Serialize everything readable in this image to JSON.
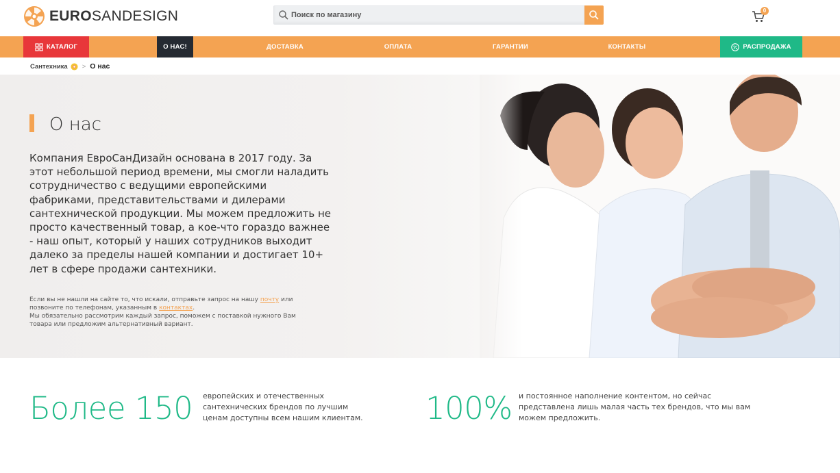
{
  "header": {
    "logo_bold": "EURO",
    "logo_rest": "SANDESIGN",
    "search_placeholder": "Поиск по магазину",
    "cart_count": "0"
  },
  "nav": {
    "catalog": "Каталог",
    "about": "О нас!",
    "delivery": "Доставка",
    "payment": "Оплата",
    "guarantee": "Гарантии",
    "contacts": "Контакты",
    "sale": "Распродажа"
  },
  "breadcrumb": {
    "home": "Сантехника",
    "separator": ">",
    "current": "О нас"
  },
  "hero": {
    "title": "О нас",
    "body": "Компания ЕвроСанДизайн основана в 2017 году. За этот небольшой период времени, мы смогли наладить сотрудничество с ведущими европейскими фабриками, представительствами и дилерами сантехнической продукции. Мы можем предложить не просто качественный товар, а кое-что гораздо важнее - наш опыт, который у наших сотрудников выходит далеко за пределы нашей компании и достигает 10+ лет в сфере продажи сантехники.",
    "note_1": "Если вы не нашли на сайте то, что искали, отправьте запрос на нашу",
    "note_link_mail": "почту",
    "note_2": "или позвоните по телефонам, указанным в",
    "note_link_contacts": "контактах",
    "note_3": ".",
    "note_4": "Мы обязательно рассмотрим каждый запрос, поможем с поставкой нужного Вам товара или предложим альтернативный вариант."
  },
  "stats": [
    {
      "big": "Более 150",
      "text": "европейских и отечественных сантехнических брендов по лучшим ценам доступны всем нашим клиентам."
    },
    {
      "big": "100%",
      "text": "и постоянное наполнение контентом, но сейчас представлена лишь малая часть тех брендов, что мы вам можем предложить."
    }
  ],
  "colors": {
    "accent_orange": "#f4a352",
    "catalog_red": "#e8373a",
    "about_dark": "#252a32",
    "sale_green": "#1fb987"
  }
}
